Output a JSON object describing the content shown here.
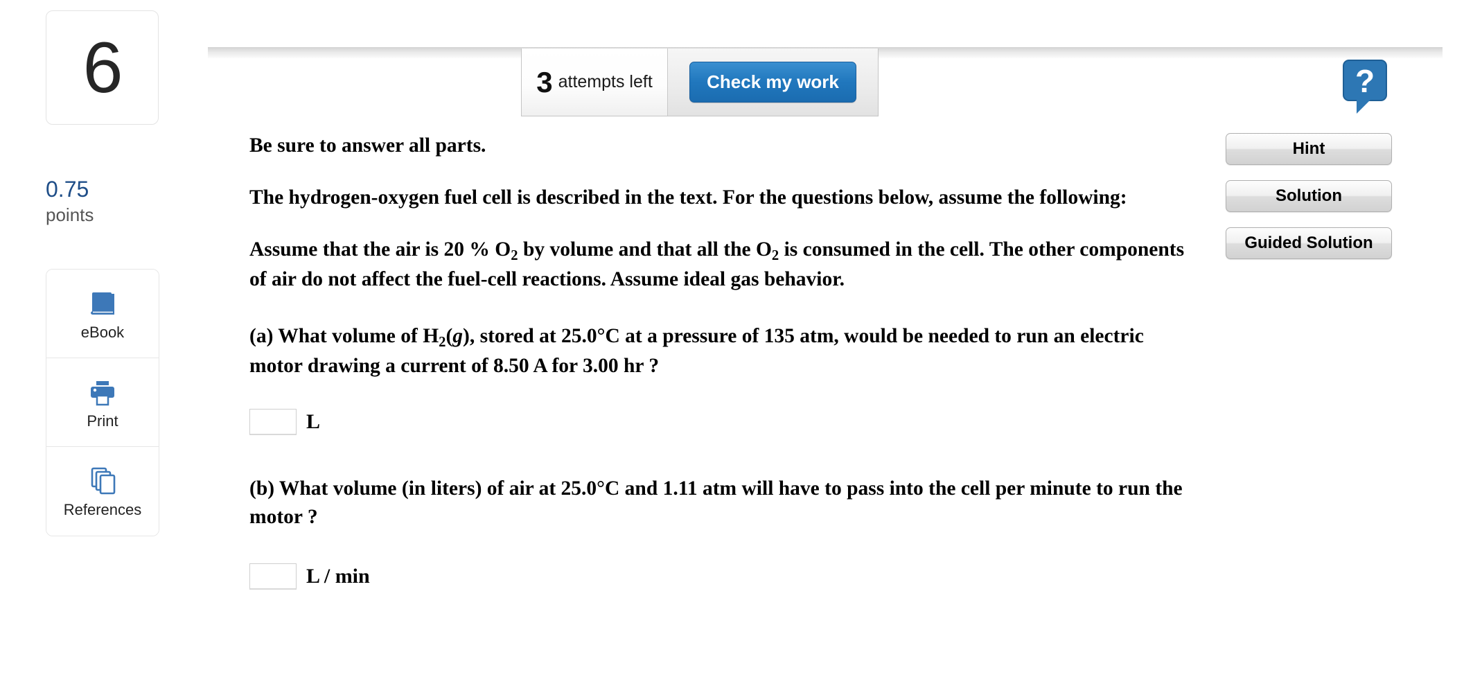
{
  "sidebar": {
    "question_number": "6",
    "points_value": "0.75",
    "points_label": "points",
    "tools": [
      {
        "label": "eBook",
        "icon": "book-icon"
      },
      {
        "label": "Print",
        "icon": "printer-icon"
      },
      {
        "label": "References",
        "icon": "references-icon"
      }
    ]
  },
  "toolbar": {
    "attempts_count": "3",
    "attempts_text": "attempts left",
    "check_label": "Check my work",
    "help_icon": "question-help-bubble-icon"
  },
  "right_panel": {
    "hint_label": "Hint",
    "solution_label": "Solution",
    "guided_solution_label": "Guided Solution"
  },
  "question": {
    "instruction": "Be sure to answer all parts.",
    "intro": "The hydrogen-oxygen fuel cell is described in the text. For the questions below, assume the following:",
    "assumption_part1": "Assume that the air is 20 % O",
    "assumption_sub1": "2",
    "assumption_part2": " by volume and that all the O",
    "assumption_sub2": "2",
    "assumption_part3": " is consumed in the cell. The other components of air do not affect the fuel-cell reactions. Assume ideal gas behavior.",
    "part_a_lead": "(a) What volume of H",
    "part_a_sub": "2",
    "part_a_italic": "g",
    "part_a_rest": "), stored at 25.0°C at a pressure of 135 atm, would be needed to run an electric motor drawing a current of 8.50 A for 3.00 hr ?",
    "part_a_answer_value": "",
    "part_a_unit": "L",
    "part_b_text": "(b) What volume (in liters) of air at 25.0°C and 1.11 atm will have to pass into the cell per minute to run the motor ?",
    "part_b_answer_value": "",
    "part_b_unit": "L / min"
  },
  "colors": {
    "accent_blue": "#1f4e88",
    "button_blue": "#2077bd",
    "icon_blue": "#3d78b8"
  }
}
